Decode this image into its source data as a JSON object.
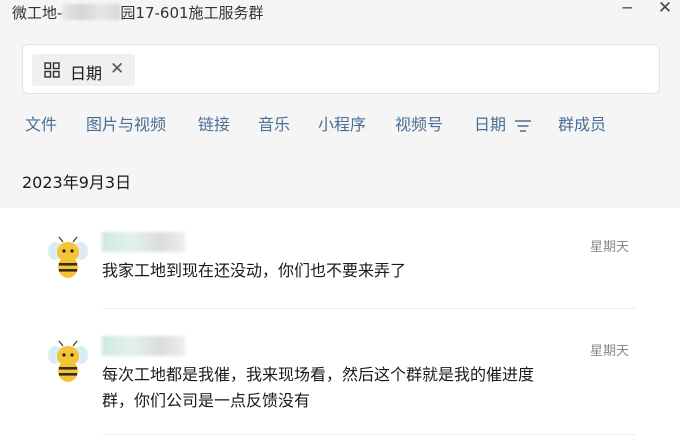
{
  "window": {
    "title_prefix": "微工地-",
    "title_suffix": "园17-601施工服务群",
    "minimize_glyph": "─",
    "close_glyph": "✕"
  },
  "search": {
    "chip_label": "日期",
    "chip_icon": "grid-icon",
    "chip_remove_glyph": "✕"
  },
  "tabs": [
    "文件",
    "图片与视频",
    "链接",
    "音乐",
    "小程序",
    "视频号",
    "日期",
    "群成员"
  ],
  "date_header": "2023年9月3日",
  "messages": [
    {
      "date": "星期天",
      "text": "我家工地到现在还没动，你们也不要来弄了"
    },
    {
      "date": "星期天",
      "text": "每次工地都是我催，我来现场看，然后这个群就是我的催进度群，你们公司是一点反馈没有"
    }
  ],
  "colors": {
    "tab_text": "#4a6f96",
    "background": "#f5f5f5",
    "list_bg": "#ffffff"
  }
}
